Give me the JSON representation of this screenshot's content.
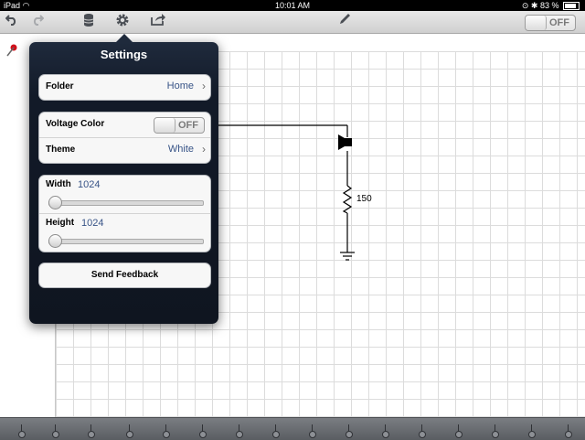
{
  "status_bar": {
    "device": "iPad",
    "time": "10:01 AM",
    "battery_text": "83 %",
    "battery_level": 0.83
  },
  "toolbar": {
    "icons": [
      "undo-icon",
      "redo-icon",
      "database-icon",
      "gear-icon",
      "share-icon",
      "pencil-icon"
    ],
    "switch_label": "OFF"
  },
  "circuit": {
    "resistor_label": "150"
  },
  "settings": {
    "title": "Settings",
    "folder": {
      "label": "Folder",
      "value": "Home"
    },
    "voltage_color": {
      "label": "Voltage Color",
      "switch_text": "OFF"
    },
    "theme": {
      "label": "Theme",
      "value": "White"
    },
    "width": {
      "label": "Width",
      "value": "1024",
      "slider_level": 0.0
    },
    "height": {
      "label": "Height",
      "value": "1024",
      "slider_level": 0.0
    },
    "send_feedback": "Send Feedback"
  },
  "colors": {
    "popover_bg": "#121a28",
    "accent_value": "#385487",
    "pin": "#d0111b"
  }
}
